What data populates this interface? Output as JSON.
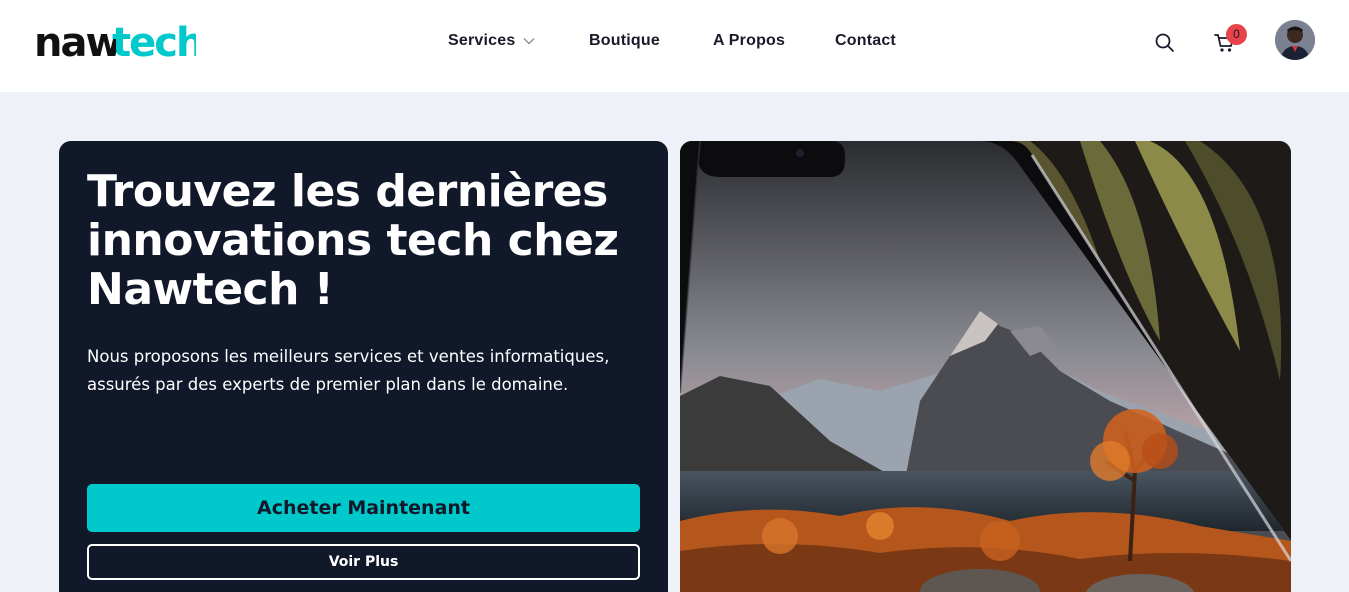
{
  "brand": {
    "name_part1": "naw",
    "name_part2": "tech",
    "colors": {
      "dark": "#111111",
      "accent": "#00c8cb"
    }
  },
  "nav": {
    "items": [
      {
        "label": "Services",
        "has_dropdown": true
      },
      {
        "label": "Boutique"
      },
      {
        "label": "A Propos"
      },
      {
        "label": "Contact"
      }
    ]
  },
  "header_actions": {
    "search_icon": "search-icon",
    "cart_icon": "cart-icon",
    "cart_count": "0",
    "avatar": "user-avatar"
  },
  "hero": {
    "title": "Trouvez les dernières innovations tech chez Nawtech !",
    "description": "Nous proposons les meilleurs services et ventes informatiques, assurés par des experts de premier plan dans le domaine.",
    "primary_button": "Acheter Maintenant",
    "secondary_button": "Voir Plus",
    "image": "smartphone-mountain-landscape"
  },
  "theme": {
    "page_bg": "#eef1f7",
    "card_bg": "#111829",
    "accent": "#00c8cb",
    "badge": "#e8434a"
  }
}
